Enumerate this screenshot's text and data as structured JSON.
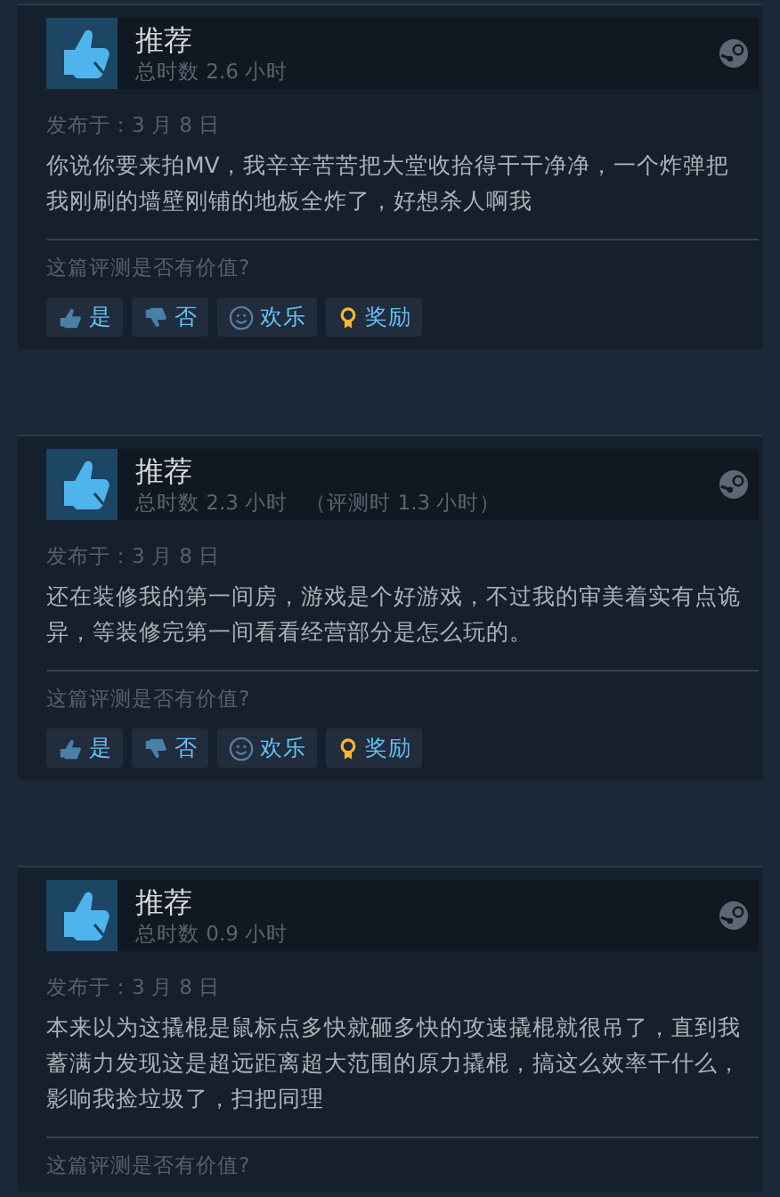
{
  "reviews": [
    {
      "verdict": "推荐",
      "hours": "总时数 2.6 小时",
      "posted": "发布于：3 月 8 日",
      "text": "你说你要来拍MV，我辛辛苦苦把大堂收拾得干干净净，一个炸弹把我刚刷的墙壁刚铺的地板全炸了，好想杀人啊我",
      "helpful_prompt": "这篇评测是否有价值?",
      "buttons": [
        {
          "kind": "yes",
          "label": "是"
        },
        {
          "kind": "no",
          "label": "否"
        },
        {
          "kind": "funny",
          "label": "欢乐"
        },
        {
          "kind": "award",
          "label": "奖励"
        }
      ]
    },
    {
      "verdict": "推荐",
      "hours": "总时数 2.3 小时",
      "review_hours": "（评测时 1.3 小时）",
      "posted": "发布于：3 月 8 日",
      "text": "还在装修我的第一间房，游戏是个好游戏，不过我的审美着实有点诡异，等装修完第一间看看经营部分是怎么玩的。",
      "helpful_prompt": "这篇评测是否有价值?",
      "buttons": [
        {
          "kind": "yes",
          "label": "是"
        },
        {
          "kind": "no",
          "label": "否"
        },
        {
          "kind": "funny",
          "label": "欢乐"
        },
        {
          "kind": "award",
          "label": "奖励"
        }
      ]
    },
    {
      "verdict": "推荐",
      "hours": "总时数 0.9 小时",
      "posted": "发布于：3 月 8 日",
      "text": "本来以为这撬棍是鼠标点多快就砸多快的攻速撬棍就很吊了，直到我蓄满力发现这是超远距离超大范围的原力撬棍，搞这么效率干什么，影响我捡垃圾了，扫把同理",
      "helpful_prompt": "这篇评测是否有价值?"
    }
  ]
}
